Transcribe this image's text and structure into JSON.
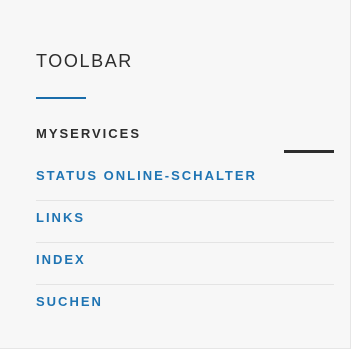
{
  "toolbar": {
    "title": "TOOLBAR",
    "accent_color": "#1a6dab",
    "items": [
      {
        "label": "MYSERVICES",
        "active": true
      },
      {
        "label": "STATUS ONLINE-SCHALTER",
        "active": false
      },
      {
        "label": "LINKS",
        "active": false
      },
      {
        "label": "INDEX",
        "active": false
      },
      {
        "label": "SUCHEN",
        "active": false
      }
    ]
  }
}
